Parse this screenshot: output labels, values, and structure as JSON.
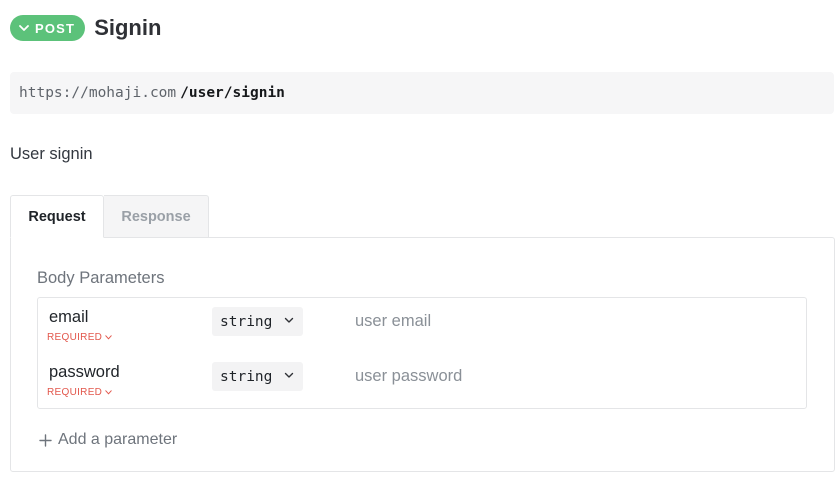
{
  "endpoint": {
    "method": "POST",
    "title": "Signin",
    "url_base": "https://mohaji.com",
    "url_path": "/user/signin",
    "description": "User signin"
  },
  "tabs": [
    {
      "label": "Request",
      "active": true
    },
    {
      "label": "Response",
      "active": false
    }
  ],
  "body_parameters": {
    "title": "Body Parameters",
    "params": [
      {
        "name": "email",
        "required_label": "REQUIRED",
        "type": "string",
        "description_placeholder": "user email"
      },
      {
        "name": "password",
        "required_label": "REQUIRED",
        "type": "string",
        "description_placeholder": "user password"
      }
    ],
    "add_label": "Add a parameter"
  },
  "colors": {
    "method_badge": "#5cc27a",
    "required": "#e2574c"
  },
  "icons": {
    "method_toggle": "chevron-down-icon",
    "required_toggle": "chevron-down-icon",
    "type_dropdown": "chevron-down-icon",
    "add": "plus-icon"
  }
}
